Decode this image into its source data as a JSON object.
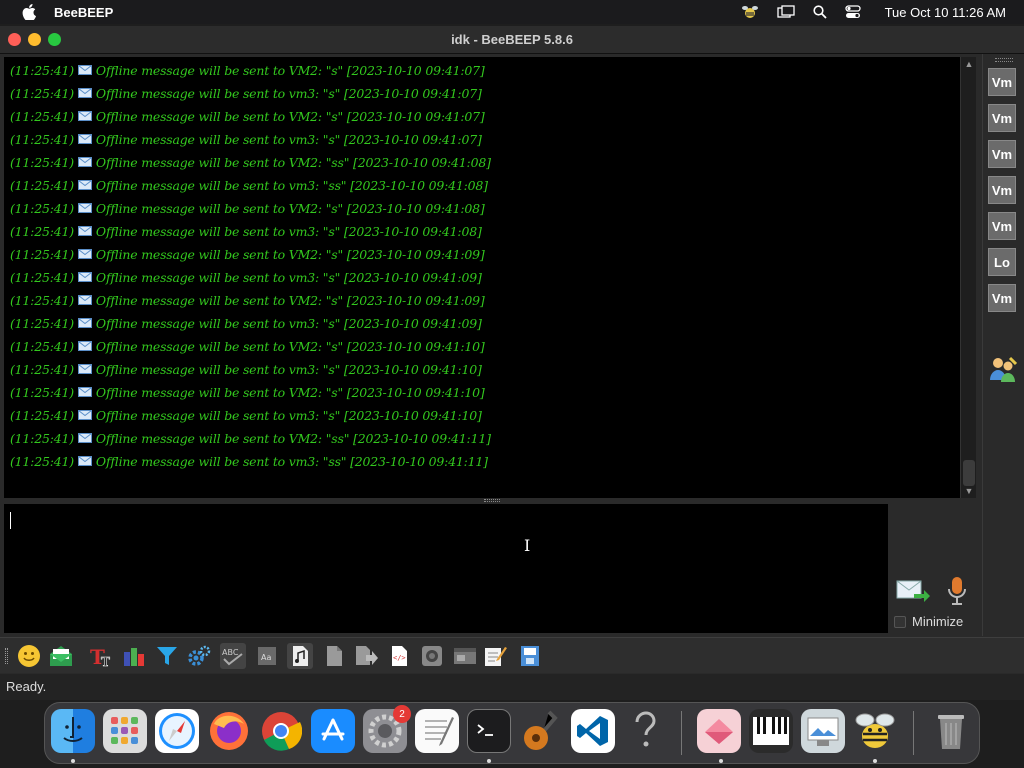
{
  "menubar": {
    "app_name": "BeeBEEP",
    "clock": "Tue Oct 10  11:26 AM"
  },
  "window": {
    "title": "idk - BeeBEEP 5.8.6"
  },
  "messages": [
    {
      "time": "(11:25:41)",
      "text": "Offline message will be sent to VM2: \"s\" [2023-10-10 09:41:07]"
    },
    {
      "time": "(11:25:41)",
      "text": "Offline message will be sent to vm3: \"s\" [2023-10-10 09:41:07]"
    },
    {
      "time": "(11:25:41)",
      "text": "Offline message will be sent to VM2: \"s\" [2023-10-10 09:41:07]"
    },
    {
      "time": "(11:25:41)",
      "text": "Offline message will be sent to vm3: \"s\" [2023-10-10 09:41:07]"
    },
    {
      "time": "(11:25:41)",
      "text": "Offline message will be sent to VM2: \"ss\" [2023-10-10 09:41:08]"
    },
    {
      "time": "(11:25:41)",
      "text": "Offline message will be sent to vm3: \"ss\" [2023-10-10 09:41:08]"
    },
    {
      "time": "(11:25:41)",
      "text": "Offline message will be sent to VM2: \"s\" [2023-10-10 09:41:08]"
    },
    {
      "time": "(11:25:41)",
      "text": "Offline message will be sent to vm3: \"s\" [2023-10-10 09:41:08]"
    },
    {
      "time": "(11:25:41)",
      "text": "Offline message will be sent to VM2: \"s\" [2023-10-10 09:41:09]"
    },
    {
      "time": "(11:25:41)",
      "text": "Offline message will be sent to vm3: \"s\" [2023-10-10 09:41:09]"
    },
    {
      "time": "(11:25:41)",
      "text": "Offline message will be sent to VM2: \"s\" [2023-10-10 09:41:09]"
    },
    {
      "time": "(11:25:41)",
      "text": "Offline message will be sent to vm3: \"s\" [2023-10-10 09:41:09]"
    },
    {
      "time": "(11:25:41)",
      "text": "Offline message will be sent to VM2: \"s\" [2023-10-10 09:41:10]"
    },
    {
      "time": "(11:25:41)",
      "text": "Offline message will be sent to vm3: \"s\" [2023-10-10 09:41:10]"
    },
    {
      "time": "(11:25:41)",
      "text": "Offline message will be sent to VM2: \"s\" [2023-10-10 09:41:10]"
    },
    {
      "time": "(11:25:41)",
      "text": "Offline message will be sent to vm3: \"s\" [2023-10-10 09:41:10]"
    },
    {
      "time": "(11:25:41)",
      "text": "Offline message will be sent to VM2: \"ss\" [2023-10-10 09:41:11]"
    },
    {
      "time": "(11:25:41)",
      "text": "Offline message will be sent to vm3: \"ss\" [2023-10-10 09:41:11]"
    }
  ],
  "compose": {
    "minimize_label": "Minimize"
  },
  "users": [
    {
      "label": "Vm"
    },
    {
      "label": "Vm"
    },
    {
      "label": "Vm"
    },
    {
      "label": "Vm"
    },
    {
      "label": "Vm"
    },
    {
      "label": "Lo"
    },
    {
      "label": "Vm"
    }
  ],
  "status": {
    "text": "Ready."
  },
  "dock": {
    "settings_badge": "2"
  },
  "colors": {
    "message_text": "#33c81e",
    "chat_background": "#000000",
    "user_button": "#6b6b6b"
  }
}
